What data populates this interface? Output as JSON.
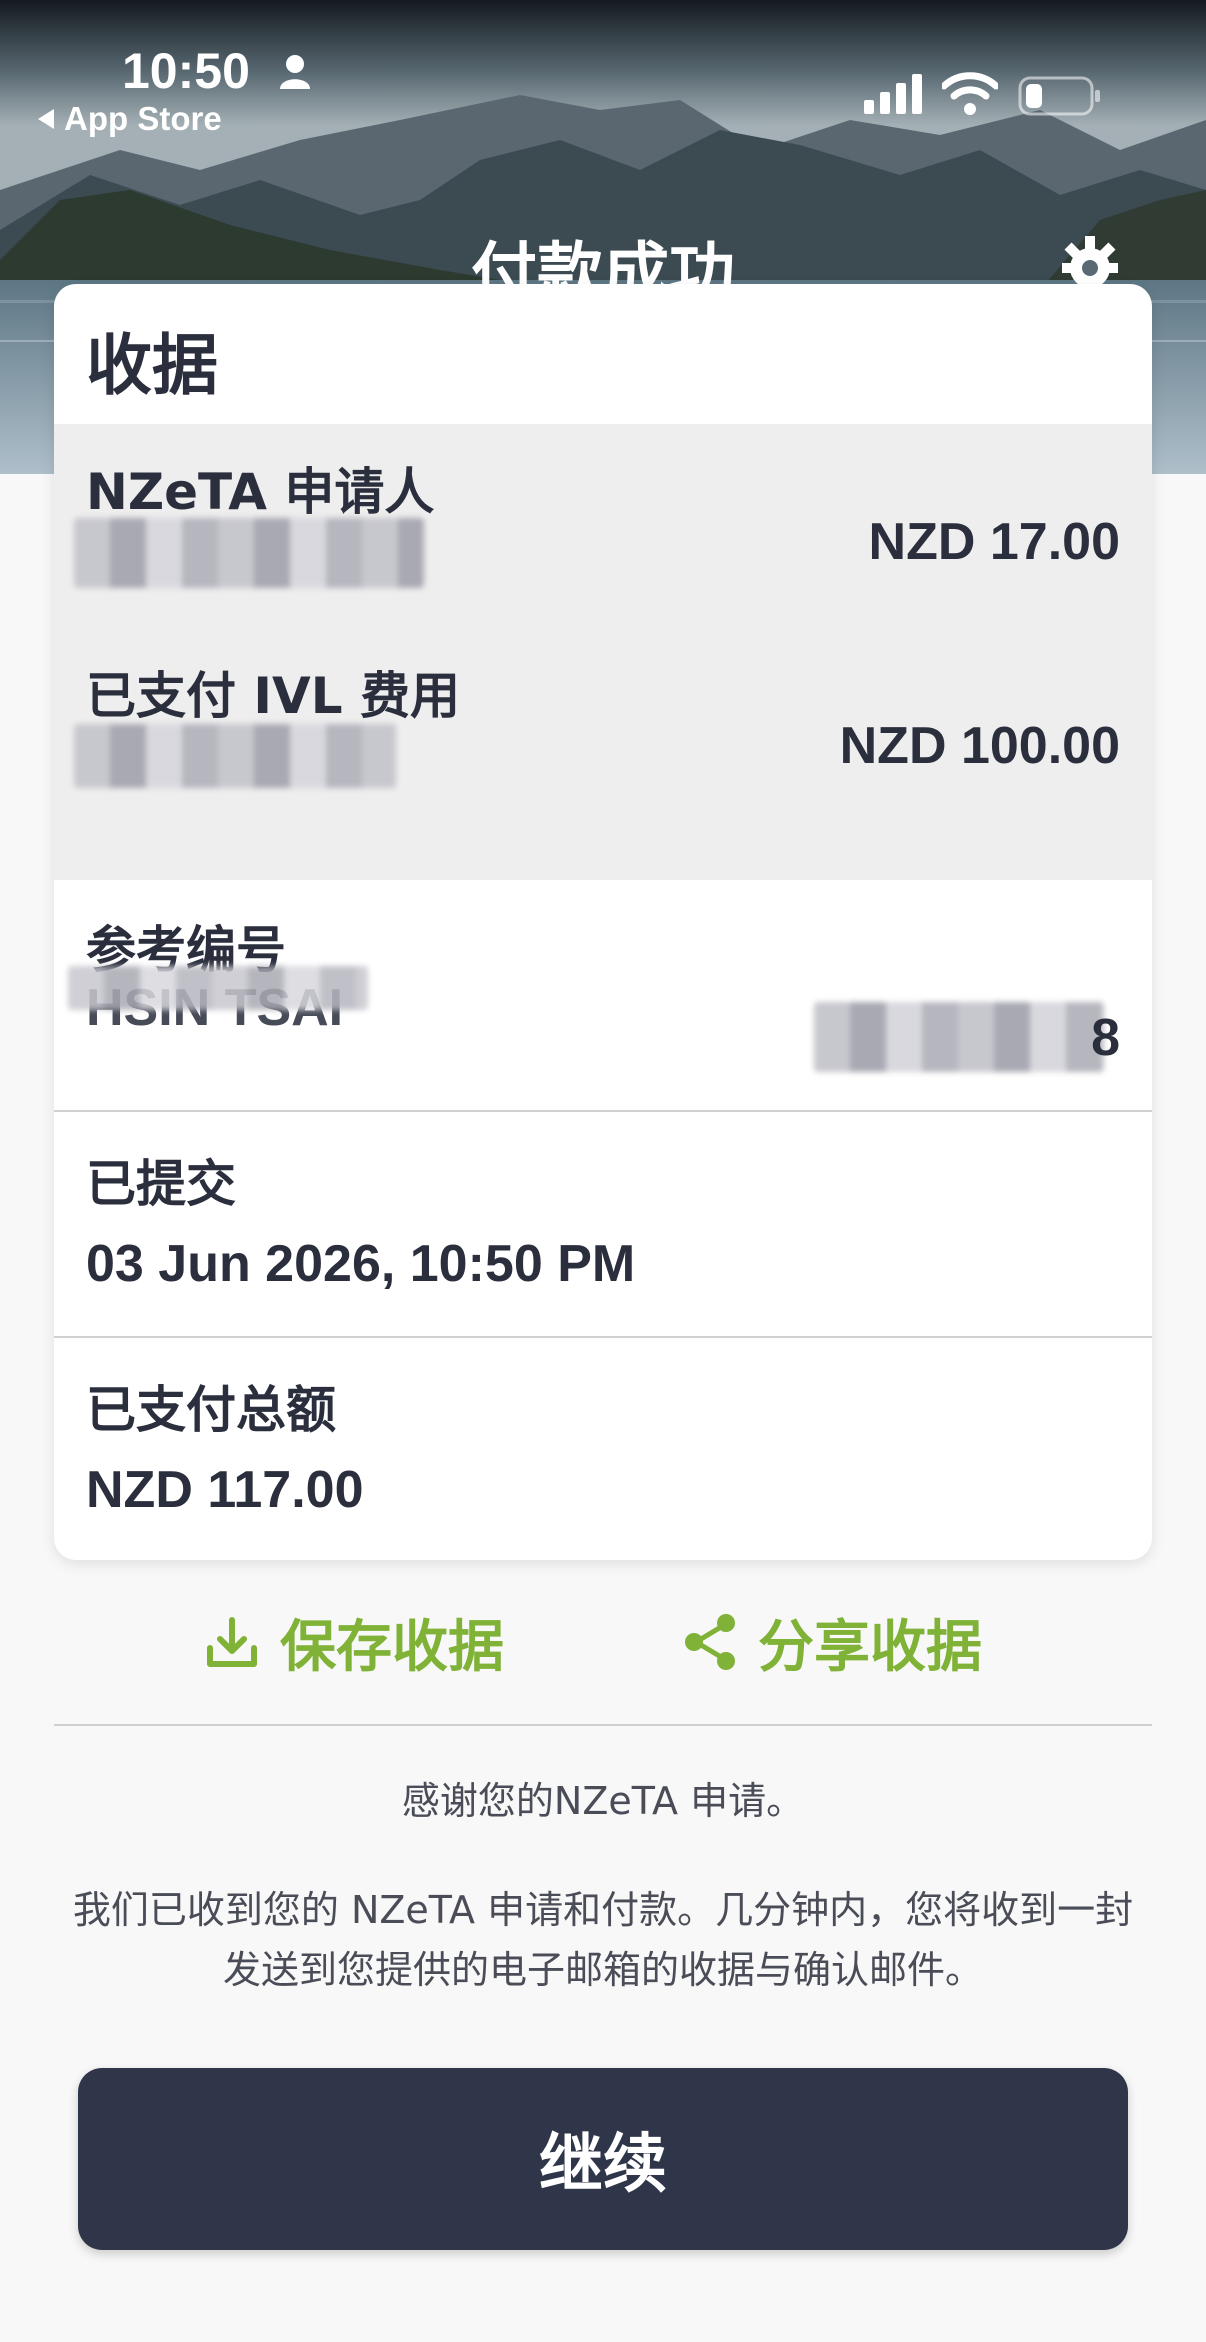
{
  "status_bar": {
    "time": "10:50",
    "back_app": "App Store"
  },
  "header": {
    "title": "付款成功"
  },
  "receipt": {
    "title": "收据",
    "fees": [
      {
        "label": "NZeTA 申请人",
        "amount": "NZD 17.00"
      },
      {
        "label": "已支付 IVL 费用",
        "amount": "NZD 100.00"
      }
    ],
    "reference": {
      "label": "参考编号",
      "name_visible": "HSIN TSAI",
      "number_visible": "8"
    },
    "submitted": {
      "label": "已提交",
      "value": "03 Jun 2026, 10:50 PM"
    },
    "total": {
      "label": "已支付总额",
      "value": "NZD 117.00"
    }
  },
  "actions": {
    "save_label": "保存收据",
    "share_label": "分享收据"
  },
  "thanks_text": "感谢您的NZeTA 申请。",
  "message_text": "我们已收到您的 NZeTA 申请和付款。几分钟内，您将收到一封发送到您提供的电子邮箱的收据与确认邮件。",
  "continue_label": "继续",
  "colors": {
    "accent_green": "#7fb236",
    "button_navy": "#30364a",
    "text_dark": "#2b2f3d"
  },
  "icons": [
    "person-icon",
    "back-arrow-icon",
    "cellular-signal-icon",
    "wifi-icon",
    "battery-icon",
    "gear-icon",
    "download-icon",
    "share-icon"
  ]
}
